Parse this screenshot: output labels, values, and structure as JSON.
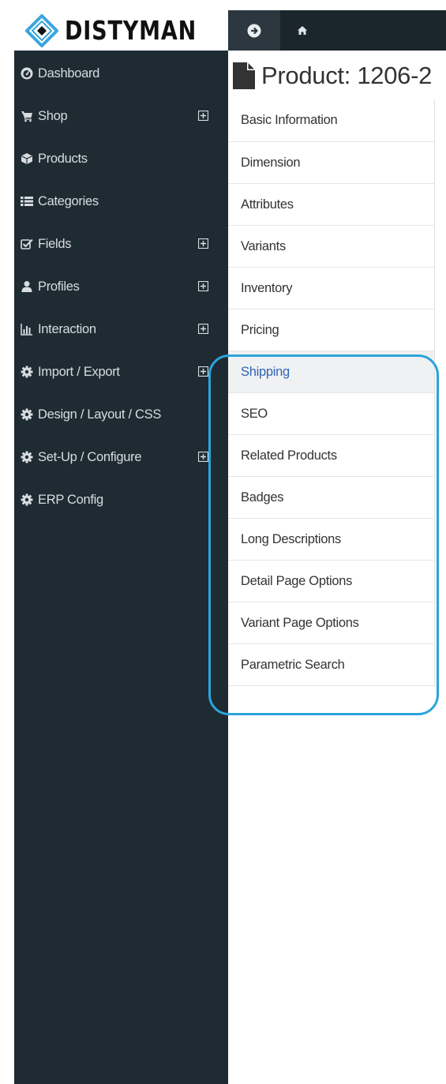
{
  "brand": {
    "name": "DISTYMAN",
    "logo_icon": "diamond-logo-icon",
    "logo_color": "#3aa6dd"
  },
  "topbar": {
    "toggle_icon": "arrow-circle-right-icon",
    "home_icon": "home-icon",
    "background": "#1b262c"
  },
  "sidebar": {
    "background": "#1f2b32",
    "items": [
      {
        "label": "Dashboard",
        "icon": "dashboard-icon",
        "expandable": false
      },
      {
        "label": "Shop",
        "icon": "cart-icon",
        "expandable": true
      },
      {
        "label": "Products",
        "icon": "cube-icon",
        "expandable": false
      },
      {
        "label": "Categories",
        "icon": "list-icon",
        "expandable": false
      },
      {
        "label": "Fields",
        "icon": "checkbox-icon",
        "expandable": true
      },
      {
        "label": "Profiles",
        "icon": "user-icon",
        "expandable": true
      },
      {
        "label": "Interaction",
        "icon": "bar-chart-icon",
        "expandable": true
      },
      {
        "label": "Import / Export",
        "icon": "gear-icon",
        "expandable": true
      },
      {
        "label": "Design / Layout / CSS",
        "icon": "gear-icon",
        "expandable": false
      },
      {
        "label": "Set-Up / Configure",
        "icon": "gear-icon",
        "expandable": true
      },
      {
        "label": "ERP Config",
        "icon": "gear-icon",
        "expandable": false
      }
    ]
  },
  "page": {
    "title": "Product: 1206-2",
    "title_icon": "file-icon"
  },
  "tabs": {
    "active": "Shipping",
    "active_color": "#2e63b8",
    "items": [
      "Basic Information",
      "Dimension",
      "Attributes",
      "Variants",
      "Inventory",
      "Pricing",
      "Shipping",
      "SEO",
      "Related Products",
      "Badges",
      "Long Descriptions",
      "Detail Page Options",
      "Variant Page Options",
      "Parametric Search"
    ]
  },
  "callout": {
    "color": "#2aa4dc"
  }
}
